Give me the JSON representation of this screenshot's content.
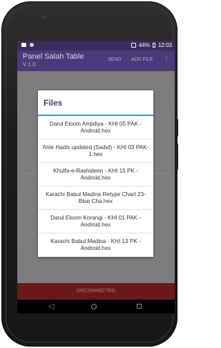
{
  "status_bar": {
    "battery": "44%",
    "time": "12:03"
  },
  "app_bar": {
    "title": "Panel Salah Table",
    "version": "V 1.0",
    "send_label": "SEND",
    "add_file_label": "ADD FILE",
    "more_icon": "⋮"
  },
  "dialog": {
    "title": "Files",
    "files": [
      "Darul Eloom Amjidiya - KHI 05 PAK - Android.hex",
      "Ahle Hadis updated (Sadaf) - KHI 03 PAK-1.hex",
      "Khulfa-e-Rashideen -  KHI 15 PK - Android.hex",
      "Karachi Babul Madina Retype Chart 23- Blue Cha.hex",
      "Darul Eloom Korangi - KHI 01 PAK - Android.hex",
      "Karachi Babul Madina - KHI 13 PK - Android.hex"
    ]
  },
  "bottom_status": "DISCONNECTED",
  "nav": {
    "back_icon": "◁"
  },
  "colors": {
    "primary": "#4b3a79",
    "status_bar": "#3a2d5e",
    "accent_divider": "#28a4d4",
    "disconnected_bg": "#6a1818"
  }
}
